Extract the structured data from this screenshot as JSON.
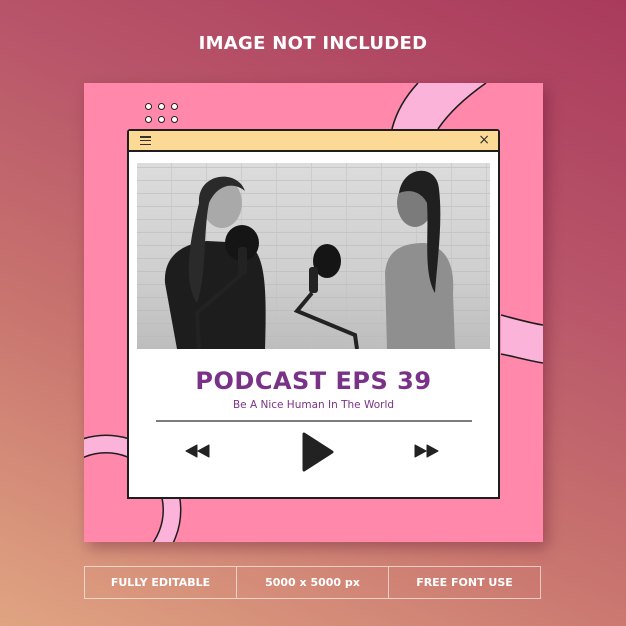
{
  "headline": "IMAGE NOT INCLUDED",
  "colors": {
    "card": "#ff88ab",
    "ring": "#fbb3d9",
    "titlebar": "#fdd996",
    "title_text": "#7a3289",
    "outline": "#1e1e1e"
  },
  "window": {
    "menu_icon": "hamburger-menu-icon",
    "close_icon": "close-icon",
    "close_glyph": "×",
    "photo_alt": "Grayscale photo of two women talking into podcast microphones in front of a white brick wall"
  },
  "episode": {
    "title": "PODCAST EPS 39",
    "subtitle": "Be A Nice Human In The World",
    "progress": 0
  },
  "controls": {
    "rewind": "rewind-icon",
    "play": "play-icon",
    "fast_forward": "fast-forward-icon"
  },
  "footer": {
    "items": [
      "FULLY EDITABLE",
      "5000 x 5000 px",
      "FREE FONT USE"
    ]
  }
}
